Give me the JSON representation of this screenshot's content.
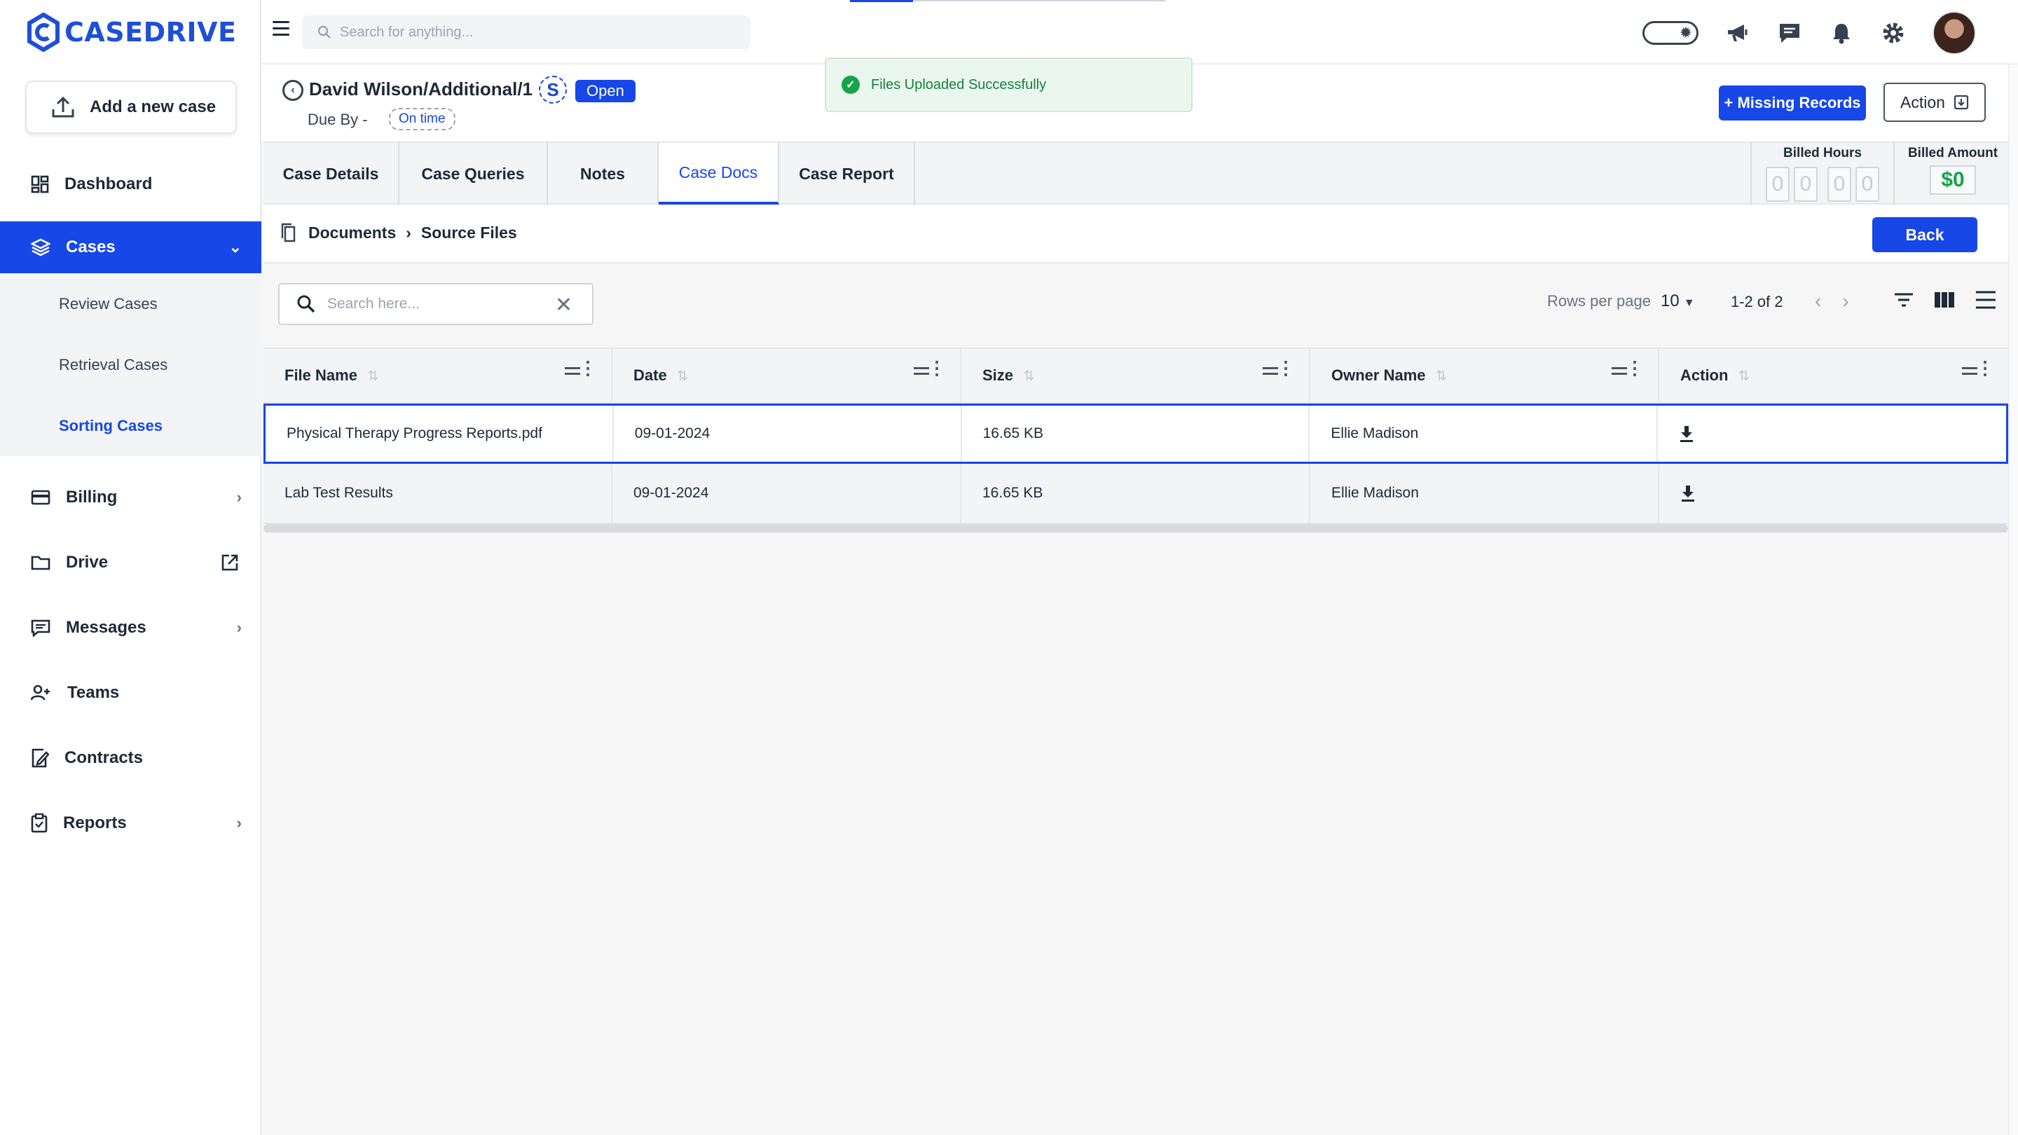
{
  "brand": {
    "name": "CASEDRIVE",
    "color": "#1f4fd8"
  },
  "colors": {
    "accent": "#1747e6",
    "success": "#16a34a"
  },
  "sidebar": {
    "add_case_label": "Add a new case",
    "items": [
      {
        "label": "Dashboard",
        "icon": "dashboard-icon"
      },
      {
        "label": "Cases",
        "icon": "layers-icon",
        "active": true
      },
      {
        "label": "Billing",
        "icon": "credit-card-icon"
      },
      {
        "label": "Drive",
        "icon": "folder-icon"
      },
      {
        "label": "Messages",
        "icon": "message-icon"
      },
      {
        "label": "Teams",
        "icon": "team-icon"
      },
      {
        "label": "Contracts",
        "icon": "contract-icon"
      },
      {
        "label": "Reports",
        "icon": "clipboard-icon"
      }
    ],
    "cases_sub": [
      {
        "label": "Review Cases"
      },
      {
        "label": "Retrieval Cases"
      },
      {
        "label": "Sorting Cases",
        "active": true
      }
    ]
  },
  "topbar": {
    "search_placeholder": "Search for anything..."
  },
  "toast": {
    "message": "Files Uploaded Successfully"
  },
  "case": {
    "title": "David Wilson/Additional/1",
    "badge_letter": "S",
    "status": "Open",
    "due_label": "Due By -",
    "due_status": "On time"
  },
  "actions": {
    "missing_records": "+ Missing Records",
    "action": "Action"
  },
  "tabs": [
    {
      "label": "Case Details"
    },
    {
      "label": "Case Queries"
    },
    {
      "label": "Notes"
    },
    {
      "label": "Case Docs",
      "active": true
    },
    {
      "label": "Case Report"
    }
  ],
  "billing": {
    "hours_title": "Billed Hours",
    "hours_digits": [
      "0",
      "0",
      "0",
      "0"
    ],
    "amount_title": "Billed Amount",
    "amount": "$0"
  },
  "breadcrumb": {
    "root": "Documents",
    "current": "Source Files",
    "back_label": "Back"
  },
  "table": {
    "search_placeholder": "Search here...",
    "rows_per_page_label": "Rows per page",
    "rows_per_page": "10",
    "range": "1-2 of 2",
    "columns": [
      "File Name",
      "Date",
      "Size",
      "Owner Name",
      "Action"
    ],
    "rows": [
      {
        "file": "Physical Therapy Progress Reports.pdf",
        "date": "09-01-2024",
        "size": "16.65 KB",
        "owner": "Ellie Madison"
      },
      {
        "file": "Lab Test Results",
        "date": "09-01-2024",
        "size": "16.65 KB",
        "owner": "Ellie Madison"
      }
    ]
  }
}
